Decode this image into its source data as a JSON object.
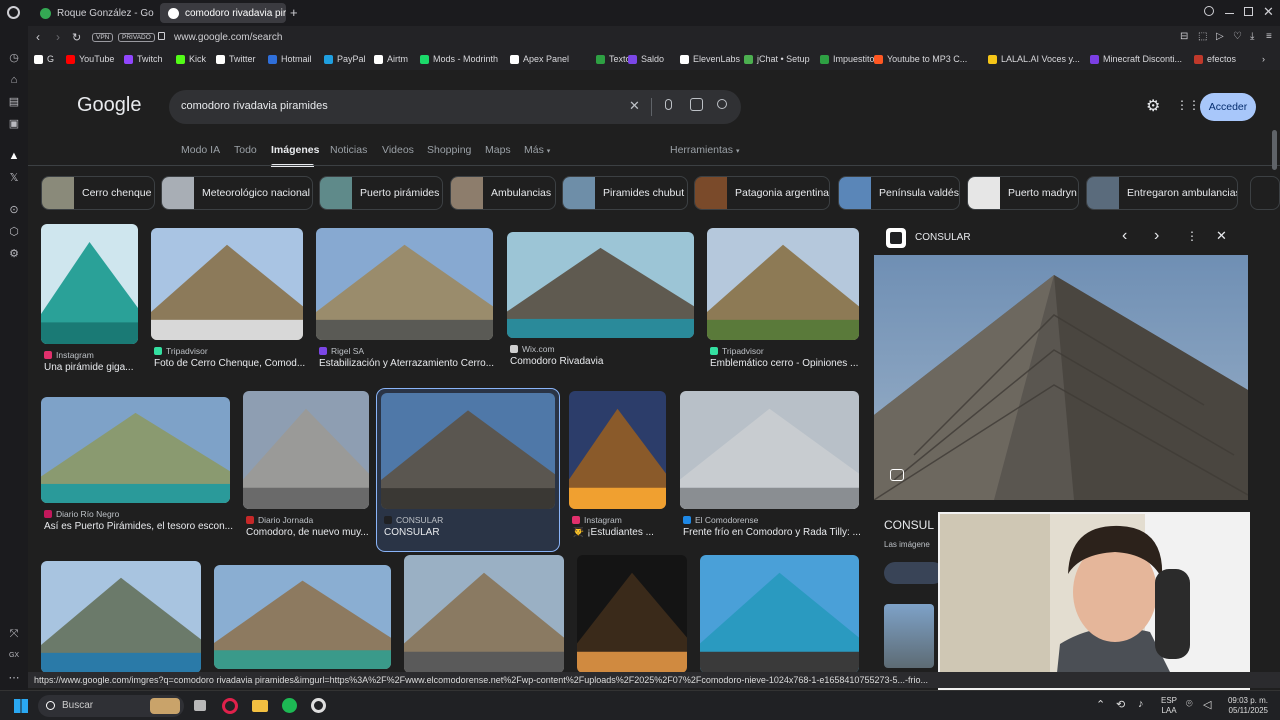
{
  "tabs": [
    {
      "label": "Roque González - Googl"
    },
    {
      "label": "comodoro rivadavia piram"
    }
  ],
  "address": {
    "vpn": "VPN",
    "private": "PRIVADO",
    "url": "www.google.com/search"
  },
  "bookmarks": [
    "G",
    "YouTube",
    "Twitch",
    "Kick",
    "Twitter",
    "Hotmail",
    "PayPal",
    "Airtm",
    "Mods - Modrinth",
    "Apex Panel",
    "Textos",
    "Saldo",
    "ElevenLabs",
    "jChat • Setup",
    "Impuestito",
    "Youtube to MP3 C...",
    "LALAL.AI Voces y...",
    "Minecraft Disconti...",
    "efectos"
  ],
  "google": {
    "logo": "Google",
    "query": "comodoro rivadavia piramides",
    "signin": "Acceder"
  },
  "nav": {
    "items": [
      "Modo IA",
      "Todo",
      "Imágenes",
      "Noticias",
      "Videos",
      "Shopping",
      "Maps",
      "Más"
    ],
    "tools": "Herramientas"
  },
  "chips": [
    "Cerro chenque",
    "Meteorológico nacional",
    "Puerto pirámides",
    "Ambulancias",
    "Piramides chubut",
    "Patagonia argentina",
    "Península valdés",
    "Puerto madryn",
    "Entregaron ambulancias"
  ],
  "results": [
    {
      "source": "Instagram",
      "title": "Una pirámide giga..."
    },
    {
      "source": "Tripadvisor",
      "title": "Foto de Cerro Chenque, Comod..."
    },
    {
      "source": "Rigel SA",
      "title": "Estabilización y Aterrazamiento Cerro..."
    },
    {
      "source": "Wix.com",
      "title": "Comodoro Rivadavia"
    },
    {
      "source": "Tripadvisor",
      "title": "Emblemático cerro - Opiniones ..."
    },
    {
      "source": "Diario Río Negro",
      "title": "Así es Puerto Pirámides, el tesoro escon..."
    },
    {
      "source": "Diario Jornada",
      "title": "Comodoro, de nuevo muy..."
    },
    {
      "source": "CONSULAR",
      "title": "CONSULAR"
    },
    {
      "source": "Instagram",
      "title": "👨‍🎓 ¡Estudiantes ..."
    },
    {
      "source": "El Comodorense",
      "title": "Frente frío en Comodoro y Rada Tilly: ..."
    }
  ],
  "panel": {
    "source": "CONSULAR",
    "title": "CONSUL",
    "subtitle": "Las imágene"
  },
  "status_url": "https://www.google.com/imgres?q=comodoro rivadavia piramides&imgurl=https%3A%2F%2Fwww.elcomodorense.net%2Fwp-content%2Fuploads%2F2025%2F07%2Fcomodoro-nieve-1024x768-1-e1658410755273-5...-frio...",
  "taskbar": {
    "search": "Buscar",
    "lang": "ESP",
    "lang2": "LAA",
    "time": "09:03 p. m.",
    "date": "05/11/2025"
  },
  "colors": {
    "accent": "#8ab4f8",
    "signin_bg": "#a8c7fa",
    "bg": "#1f1f1f"
  }
}
